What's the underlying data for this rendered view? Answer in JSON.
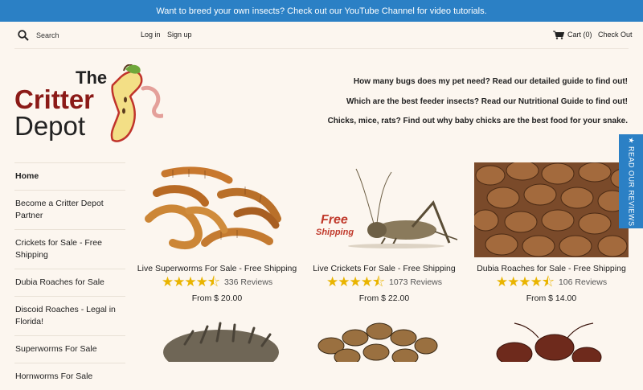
{
  "announcement": "Want to breed your own insects? Check out our YouTube Channel for video tutorials.",
  "header": {
    "search_placeholder": "Search",
    "login": "Log in",
    "signup": "Sign up",
    "cart": "Cart (0)",
    "checkout": "Check Out"
  },
  "logo": {
    "line1": "The",
    "line2": "Critter",
    "line3": "Depot"
  },
  "promos": [
    "How many bugs does my pet need? Read our detailed guide to find out!",
    "Which are the best feeder insects? Read our Nutritional Guide to find out!",
    "Chicks, mice, rats? Find out why baby chicks are the best food for your snake."
  ],
  "sidebar": [
    "Home",
    "Become a Critter Depot Partner",
    "Crickets for Sale - Free Shipping",
    "Dubia Roaches for Sale",
    "Discoid Roaches - Legal in Florida!",
    "Superworms For Sale",
    "Hornworms For Sale"
  ],
  "products": [
    {
      "title": "Live Superworms For Sale - Free Shipping",
      "reviews": "336 Reviews",
      "price": "From $ 20.00",
      "rating": 4.5
    },
    {
      "title": "Live Crickets For Sale - Free Shipping",
      "reviews": "1073 Reviews",
      "price": "From $ 22.00",
      "rating": 4.5,
      "badge": "Free Shipping"
    },
    {
      "title": "Dubia Roaches for Sale - Free Shipping",
      "reviews": "106 Reviews",
      "price": "From $ 14.00",
      "rating": 4.5
    }
  ],
  "reviews_tab": "★ READ OUR REVIEWS",
  "colors": {
    "accent": "#2b80c5",
    "background": "#fcf6ef",
    "star": "#e9b400"
  }
}
